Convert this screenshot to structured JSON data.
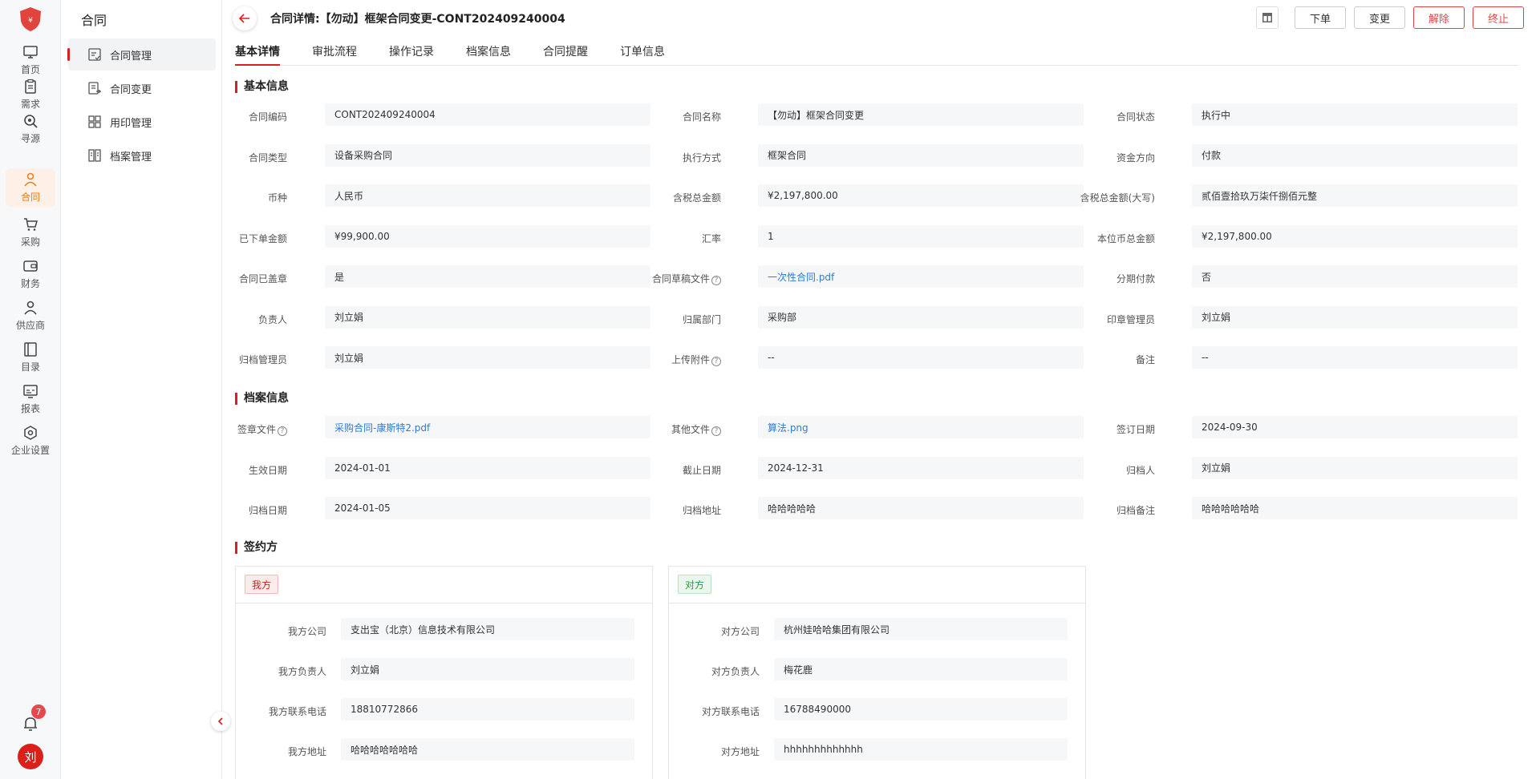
{
  "rail": {
    "items": [
      {
        "label": "首页",
        "icon": "monitor-icon"
      },
      {
        "label": "需求",
        "icon": "clipboard-icon"
      },
      {
        "label": "寻源",
        "icon": "search-icon"
      },
      {
        "label": "合同",
        "icon": "person-icon",
        "active": true
      },
      {
        "label": "采购",
        "icon": "cart-icon"
      },
      {
        "label": "财务",
        "icon": "wallet-icon"
      },
      {
        "label": "供应商",
        "icon": "supplier-icon"
      },
      {
        "label": "目录",
        "icon": "book-icon"
      },
      {
        "label": "报表",
        "icon": "report-icon"
      },
      {
        "label": "企业设置",
        "icon": "settings-icon"
      }
    ],
    "notification_count": "7",
    "avatar_text": "刘",
    "accent": "#f07c1a"
  },
  "submenu": {
    "title": "合同",
    "items": [
      {
        "label": "合同管理",
        "active": true
      },
      {
        "label": "合同变更"
      },
      {
        "label": "用印管理"
      },
      {
        "label": "档案管理"
      }
    ]
  },
  "header": {
    "title": "合同详情:【勿动】框架合同变更-CONT202409240004",
    "actions": {
      "order": "下单",
      "change": "变更",
      "release": "解除",
      "terminate": "终止"
    }
  },
  "tabs": [
    "基本详情",
    "审批流程",
    "操作记录",
    "档案信息",
    "合同提醒",
    "订单信息"
  ],
  "basic": {
    "title": "基本信息",
    "fields": [
      {
        "label": "合同编码",
        "value": "CONT202409240004"
      },
      {
        "label": "合同名称",
        "value": "【勿动】框架合同变更"
      },
      {
        "label": "合同状态",
        "value": "执行中"
      },
      {
        "label": "合同类型",
        "value": "设备采购合同"
      },
      {
        "label": "执行方式",
        "value": "框架合同"
      },
      {
        "label": "资金方向",
        "value": "付款"
      },
      {
        "label": "币种",
        "value": "人民币"
      },
      {
        "label": "含税总金额",
        "value": "¥2,197,800.00"
      },
      {
        "label": "含税总金额(大写)",
        "value": "贰佰壹拾玖万柒仟捌佰元整"
      },
      {
        "label": "已下单金额",
        "value": "¥99,900.00"
      },
      {
        "label": "汇率",
        "value": "1"
      },
      {
        "label": "本位币总金额",
        "value": "¥2,197,800.00"
      },
      {
        "label": "合同已盖章",
        "value": "是"
      },
      {
        "label": "合同草稿文件",
        "value": "一次性合同.pdf",
        "link": true,
        "help": true
      },
      {
        "label": "分期付款",
        "value": "否"
      },
      {
        "label": "负责人",
        "value": "刘立娟"
      },
      {
        "label": "归属部门",
        "value": "采购部"
      },
      {
        "label": "印章管理员",
        "value": "刘立娟"
      },
      {
        "label": "归档管理员",
        "value": "刘立娟"
      },
      {
        "label": "上传附件",
        "value": "--",
        "help": true
      },
      {
        "label": "备注",
        "value": "--"
      }
    ]
  },
  "archive": {
    "title": "档案信息",
    "fields": [
      {
        "label": "签章文件",
        "value": "采购合同-康斯特2.pdf",
        "link": true,
        "help": true
      },
      {
        "label": "其他文件",
        "value": "算法.png",
        "link": true,
        "help": true
      },
      {
        "label": "签订日期",
        "value": "2024-09-30"
      },
      {
        "label": "生效日期",
        "value": "2024-01-01"
      },
      {
        "label": "截止日期",
        "value": "2024-12-31"
      },
      {
        "label": "归档人",
        "value": "刘立娟"
      },
      {
        "label": "归档日期",
        "value": "2024-01-05"
      },
      {
        "label": "归档地址",
        "value": "哈哈哈哈哈"
      },
      {
        "label": "归档备注",
        "value": "哈哈哈哈哈哈"
      }
    ]
  },
  "parties": {
    "title": "签约方",
    "ours": {
      "tag": "我方",
      "fields": [
        {
          "label": "我方公司",
          "value": "支出宝（北京）信息技术有限公司"
        },
        {
          "label": "我方负责人",
          "value": "刘立娟"
        },
        {
          "label": "我方联系电话",
          "value": "18810772866"
        },
        {
          "label": "我方地址",
          "value": "哈哈哈哈哈哈哈"
        }
      ]
    },
    "theirs": {
      "tag": "对方",
      "fields": [
        {
          "label": "对方公司",
          "value": "杭州娃哈哈集团有限公司"
        },
        {
          "label": "对方负责人",
          "value": "梅花鹿"
        },
        {
          "label": "对方联系电话",
          "value": "16788490000"
        },
        {
          "label": "对方地址",
          "value": "hhhhhhhhhhhhh"
        }
      ]
    }
  }
}
